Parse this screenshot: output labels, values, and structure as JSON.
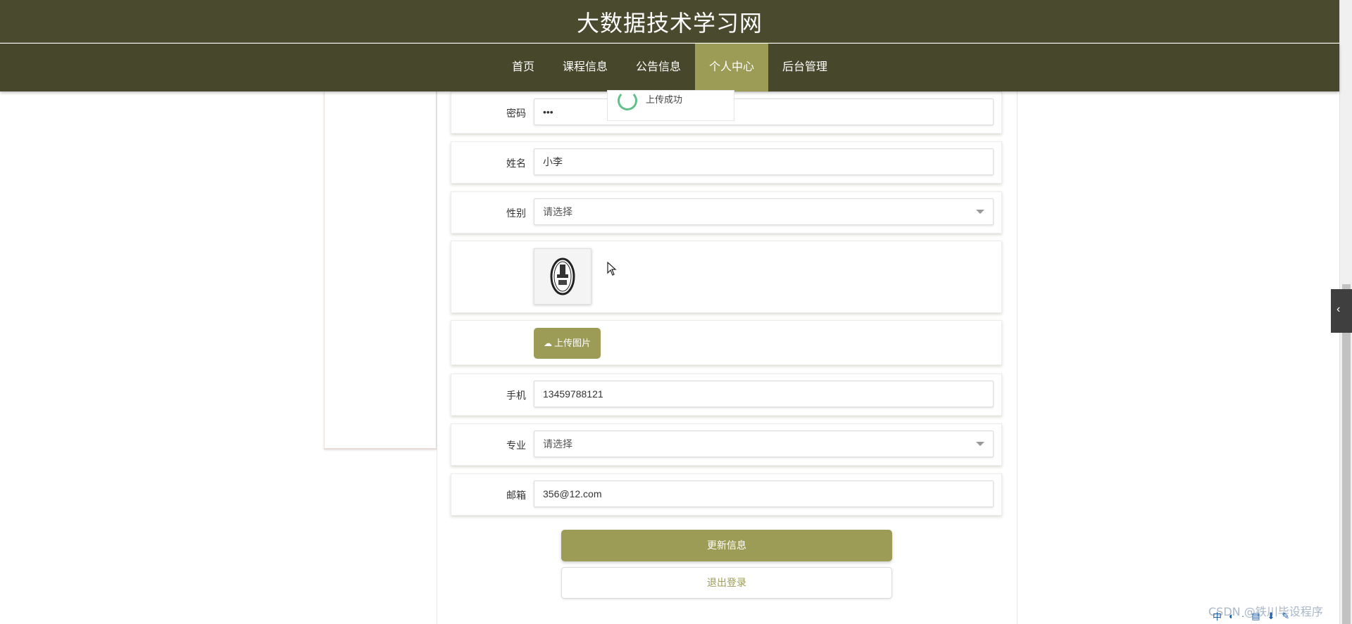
{
  "header": {
    "site_title": "大数据技术学习网"
  },
  "nav": {
    "items": [
      {
        "label": "首页",
        "active": false
      },
      {
        "label": "课程信息",
        "active": false
      },
      {
        "label": "公告信息",
        "active": false
      },
      {
        "label": "个人中心",
        "active": true
      },
      {
        "label": "后台管理",
        "active": false
      }
    ]
  },
  "toast": {
    "message": "上传成功",
    "icon": "smiley-icon"
  },
  "form": {
    "password": {
      "label": "密码",
      "value": "•••"
    },
    "name": {
      "label": "姓名",
      "value": "小李"
    },
    "gender": {
      "label": "性别",
      "value": "请选择"
    },
    "avatar": {
      "icon": "avatar-image"
    },
    "upload": {
      "label": "上传图片",
      "icon": "cloud-upload-icon"
    },
    "phone": {
      "label": "手机",
      "value": "13459788121"
    },
    "major": {
      "label": "专业",
      "value": "请选择"
    },
    "email": {
      "label": "邮箱",
      "value": "356@12.com"
    }
  },
  "actions": {
    "update_label": "更新信息",
    "logout_label": "退出登录"
  },
  "watermark": "CSDN @铁川毕设程序",
  "tray": {
    "items": [
      "中",
      "◐",
      "·",
      "▤",
      "⬇",
      "✎"
    ]
  },
  "colors": {
    "header_bg": "#4a4a2e",
    "accent": "#9c9c56"
  }
}
